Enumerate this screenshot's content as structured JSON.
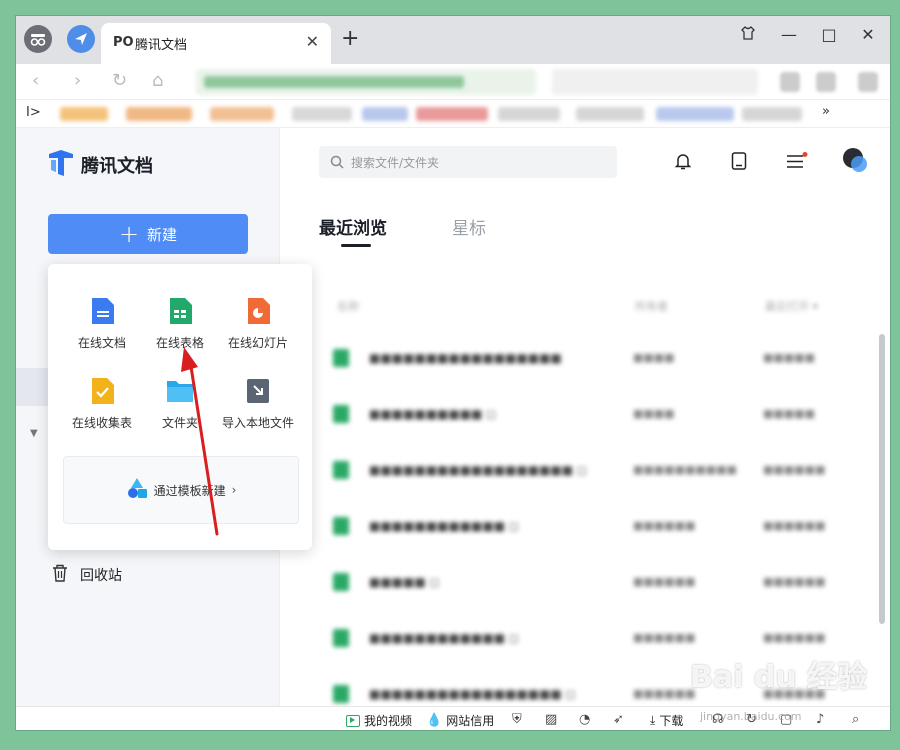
{
  "browser": {
    "tab_title": "腾讯文档",
    "tab_favicon": "PO",
    "new_tab": "+",
    "window_controls": [
      "☰",
      "—",
      "□",
      "✕"
    ]
  },
  "app": {
    "logo_text": "腾讯文档",
    "new_button_label": "新建",
    "trash_label": "回收站",
    "search_placeholder": "搜索文件/文件夹"
  },
  "create_menu": {
    "items": [
      {
        "label": "在线文档",
        "icon": "doc-icon",
        "color": "#3a7cf0"
      },
      {
        "label": "在线表格",
        "icon": "sheet-icon",
        "color": "#22a86a"
      },
      {
        "label": "在线幻灯片",
        "icon": "slides-icon",
        "color": "#f06a35"
      },
      {
        "label": "在线收集表",
        "icon": "form-icon",
        "color": "#f2b21a"
      },
      {
        "label": "文件夹",
        "icon": "folder-icon",
        "color": "#28a7ea"
      },
      {
        "label": "导入本地文件",
        "icon": "import-icon",
        "color": "#5b6473"
      }
    ],
    "template_label": "通过模板新建"
  },
  "main": {
    "tabs": [
      "最近浏览",
      "星标"
    ],
    "active_tab": "最近浏览"
  },
  "statusbar": {
    "my_video": "我的视频",
    "site_credit": "网站信用",
    "download": "下载"
  },
  "watermark": {
    "text": "Bai du 经验",
    "sub": "jingyan.baidu.com"
  },
  "colors": {
    "primary": "#4f8cf6",
    "sheet_green": "#22a86a",
    "arrow": "#d81e1e",
    "background": "#7dc49a"
  }
}
